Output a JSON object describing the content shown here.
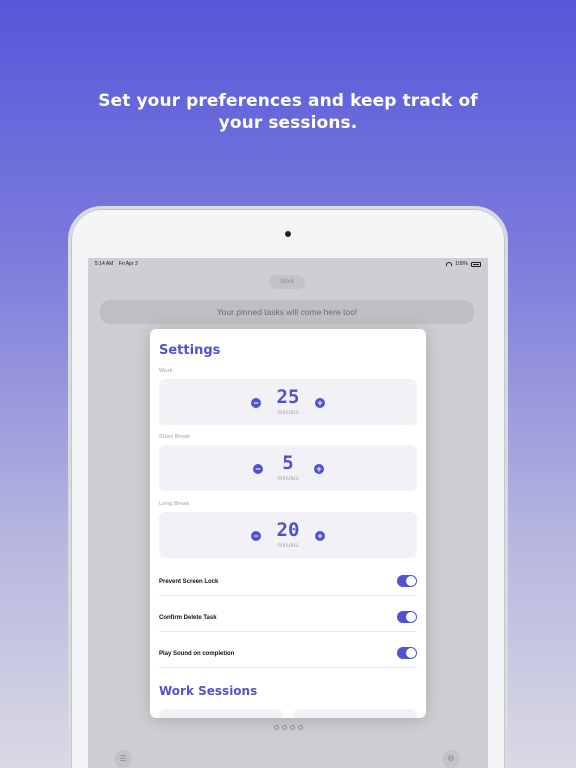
{
  "headline": "Set your preferences and keep track of your sessions.",
  "statusbar": {
    "time": "5:14 AM",
    "date": "Fri Apr 3",
    "battery": "100%"
  },
  "background": {
    "work_pill": "Work",
    "pinned_text": "Your pinned tasks will come here too!"
  },
  "settings": {
    "title": "Settings",
    "steppers": [
      {
        "label": "Work",
        "value": "25",
        "unit": "minutes"
      },
      {
        "label": "Short Break",
        "value": "5",
        "unit": "minutes"
      },
      {
        "label": "Long Break",
        "value": "20",
        "unit": "minutes"
      }
    ],
    "toggles": [
      {
        "label": "Prevent Screen Lock",
        "on": true
      },
      {
        "label": "Confirm Delete Task",
        "on": true
      },
      {
        "label": "Play Sound on completion",
        "on": true
      }
    ],
    "sessions_title": "Work Sessions"
  },
  "page_dots": 4,
  "colors": {
    "accent": "#5252d1",
    "bg_top": "#5757da",
    "bg_bottom": "#d9d9e3"
  },
  "icons": {
    "minus": "minus-icon",
    "plus": "plus-icon",
    "menu": "menu-icon",
    "gear": "gear-icon"
  }
}
